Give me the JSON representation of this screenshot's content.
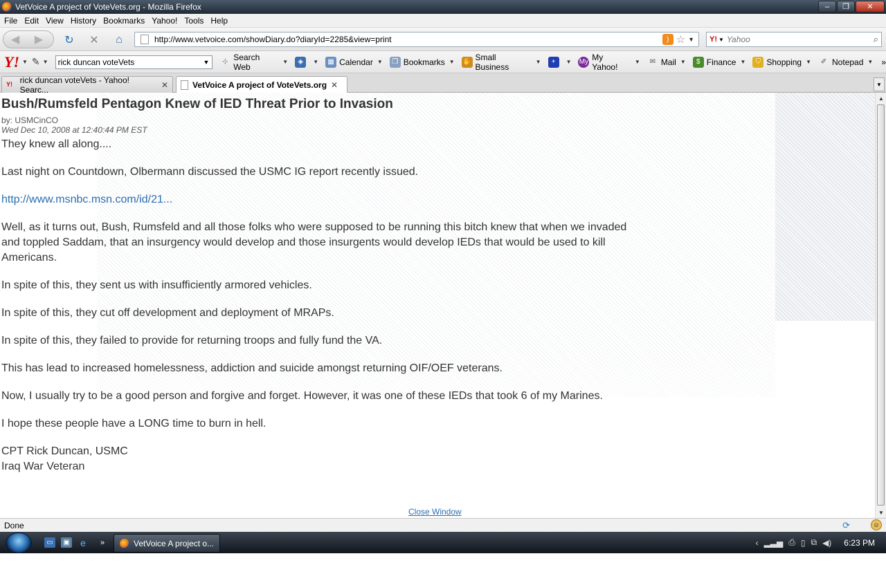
{
  "window": {
    "title": "VetVoice A project of VoteVets.org - Mozilla Firefox",
    "minimize": "–",
    "maximize": "❐",
    "close": "✕"
  },
  "menu": {
    "items": [
      "File",
      "Edit",
      "View",
      "History",
      "Bookmarks",
      "Yahoo!",
      "Tools",
      "Help"
    ]
  },
  "nav": {
    "url": "http://www.vetvoice.com/showDiary.do?diaryId=2285&view=print",
    "search_placeholder": "Yahoo"
  },
  "yahoo_toolbar": {
    "search_value": "rick duncan voteVets",
    "items": [
      "Search Web",
      "Calendar",
      "Bookmarks",
      "Small Business",
      "My Yahoo!",
      "Mail",
      "Finance",
      "Shopping",
      "Notepad"
    ]
  },
  "tabs": [
    {
      "label": "rick duncan voteVets - Yahoo! Searc..."
    },
    {
      "label": "VetVoice A project of VoteVets.org"
    }
  ],
  "article": {
    "title": "Bush/Rumsfeld Pentagon Knew of IED Threat Prior to Invasion",
    "byline": "by: USMCinCO",
    "date": "Wed Dec 10, 2008 at 12:40:44 PM EST",
    "paragraphs": [
      "They knew all along....",
      "Last night on Countdown, Olbermann discussed the USMC IG report recently issued.",
      "http://www.msnbc.msn.com/id/21...",
      "Well, as it turns out, Bush, Rumsfeld and all those folks who were supposed to be running this bitch knew that when we invaded and toppled Saddam, that an insurgency would develop and those insurgents would develop IEDs that would be used to kill Americans.",
      "In spite of this, they sent us with insufficiently  armored vehicles.",
      "In spite of this, they cut off development and deployment of MRAPs.",
      "In spite of this, they failed to provide for returning troops and fully fund the VA.",
      "This has lead to increased homelessness, addiction and suicide amongst returning OIF/OEF veterans.",
      "Now, I usually try to be a good person and forgive and forget. However, it was one of these IEDs that took 6 of my Marines.",
      "I hope these people have a LONG time to burn in  hell."
    ],
    "signature_line1": "CPT Rick Duncan, USMC",
    "signature_line2": "Iraq War Veteran",
    "close_window": "Close Window"
  },
  "status": {
    "text": "Done"
  },
  "taskbar": {
    "task_label": "VetVoice A project o...",
    "clock": "6:23 PM"
  }
}
